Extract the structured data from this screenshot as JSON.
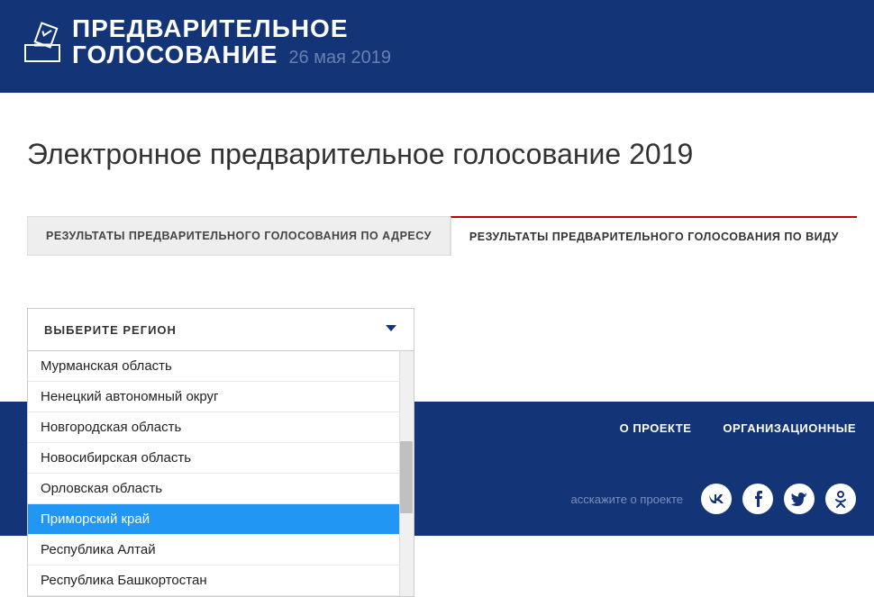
{
  "header": {
    "logo_line1": "ПРЕДВАРИТЕЛЬНОЕ",
    "logo_line2": "ГОЛОСОВАНИЕ",
    "date": "26 мая 2019"
  },
  "page": {
    "title": "Электронное предварительное голосование 2019"
  },
  "tabs": {
    "inactive": "РЕЗУЛЬТАТЫ ПРЕДВАРИТЕЛЬНОГО ГОЛОСОВАНИЯ ПО АДРЕСУ",
    "active": "РЕЗУЛЬТАТЫ ПРЕДВАРИТЕЛЬНОГО ГОЛОСОВАНИЯ ПО ВИДУ"
  },
  "dropdown": {
    "label": "ВЫБЕРИТЕ РЕГИОН",
    "items": [
      "Мурманская область",
      "Ненецкий автономный округ",
      "Новгородская область",
      "Новосибирская область",
      "Орловская область",
      "Приморский край",
      "Республика Алтай",
      "Республика Башкортостан"
    ],
    "selected_index": 5
  },
  "footer": {
    "links": {
      "about": "О ПРОЕКТЕ",
      "org": "ОРГАНИЗАЦИОННЫЕ"
    },
    "share_label": "асскажите о проекте",
    "social": {
      "vk": "W",
      "fb": "f",
      "tw": "t",
      "ok": "ok"
    }
  }
}
